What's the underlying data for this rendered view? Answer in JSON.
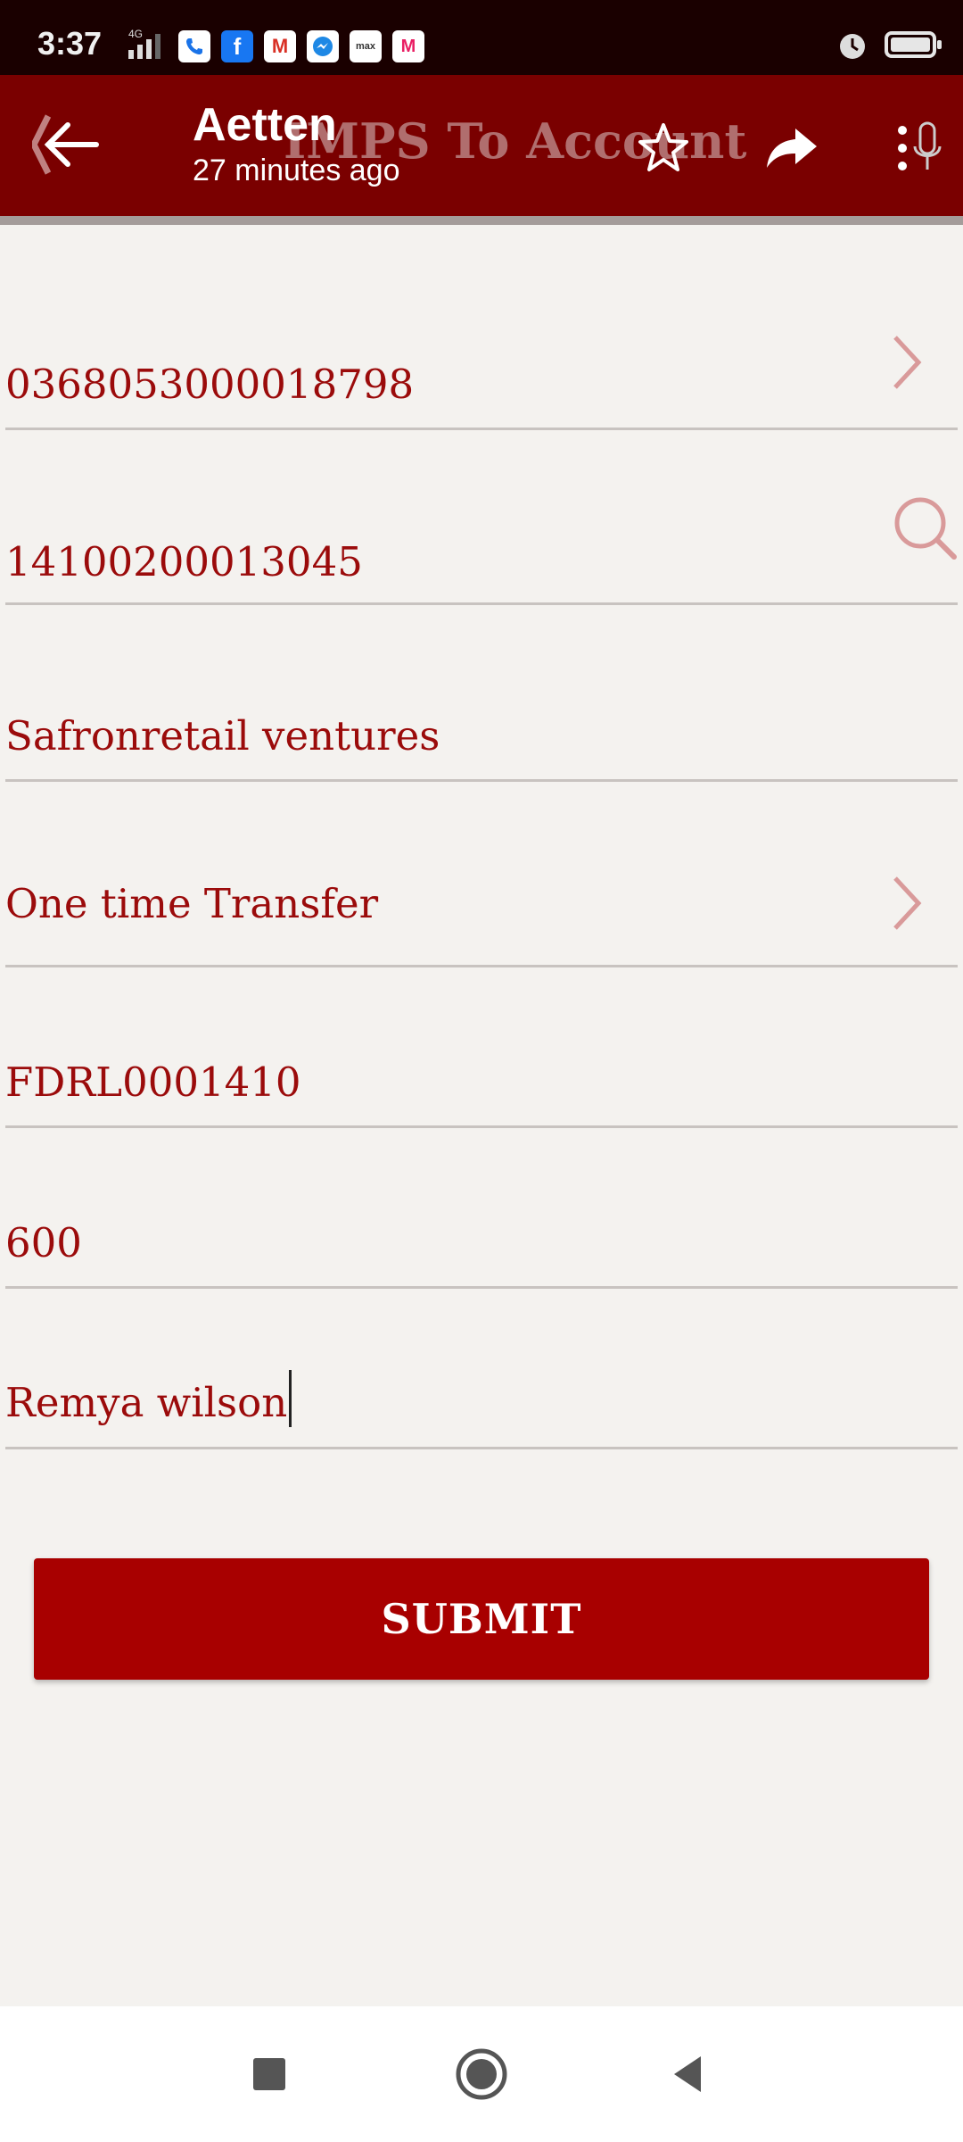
{
  "status_bar": {
    "time": "3:37",
    "network": "4G",
    "notification_icons": [
      "phone-icon",
      "facebook-icon",
      "gmail-icon",
      "messenger-icon",
      "max-icon",
      "myntra-icon"
    ],
    "notif_labels": {
      "facebook": "f",
      "gmail": "M",
      "max": "max",
      "myntra": "M"
    }
  },
  "header": {
    "title": "Aetten",
    "subtitle": "27 minutes ago",
    "page_title": "IMPS To Account",
    "bg_color": "#7a0000"
  },
  "form": {
    "from_account": "0368053000018798",
    "beneficiary_account": "14100200013045",
    "beneficiary_name": "Safronretail ventures",
    "transfer_type": "One time Transfer",
    "ifsc": "FDRL0001410",
    "amount": "600",
    "remarks": "Remya wilson"
  },
  "submit": {
    "label": "SUBMIT",
    "color": "#a80000"
  },
  "colors": {
    "text": "#9b0b0b",
    "background": "#f4f2ef"
  }
}
